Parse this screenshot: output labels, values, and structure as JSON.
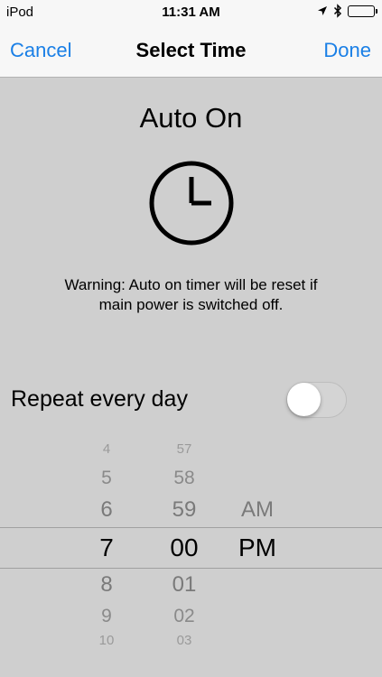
{
  "status_bar": {
    "carrier": "iPod",
    "time": "11:31 AM"
  },
  "nav": {
    "cancel": "Cancel",
    "title": "Select Time",
    "done": "Done"
  },
  "heading": "Auto On",
  "warning": {
    "line1": "Warning: Auto on timer will be reset if",
    "line2": "main power is switched off."
  },
  "repeat": {
    "label": "Repeat every day",
    "on": false
  },
  "picker": {
    "hours": [
      "4",
      "5",
      "6",
      "7",
      "8",
      "9",
      "10"
    ],
    "minutes": [
      "57",
      "58",
      "59",
      "00",
      "01",
      "02",
      "03"
    ],
    "period": [
      "AM",
      "PM"
    ],
    "selected": {
      "hour": "7",
      "minute": "00",
      "period": "PM"
    }
  },
  "colors": {
    "accent": "#1a7fe6",
    "background": "#cfcfcf",
    "bar": "#f7f7f7"
  }
}
